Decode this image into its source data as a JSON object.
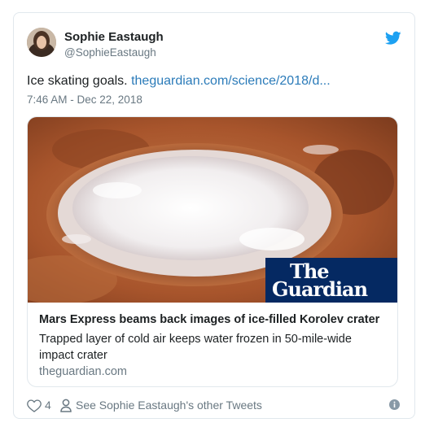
{
  "author": {
    "display_name": "Sophie Eastaugh",
    "handle": "@SophieEastaugh"
  },
  "tweet": {
    "text": "Ice skating goals. ",
    "link_text": "theguardian.com/science/2018/d...",
    "timestamp": "7:46 AM - Dec 22, 2018"
  },
  "link_card": {
    "logo_line1": "The",
    "logo_line2": "Guardian",
    "title": "Mars Express beams back images of ice-filled Korolev crater",
    "description": "Trapped layer of cold air keeps water frozen in 50-mile-wide impact crater",
    "domain": "theguardian.com"
  },
  "footer": {
    "like_count": "4",
    "other_tweets_label": "See Sophie Eastaugh's other Tweets"
  },
  "icons": {
    "twitter": "twitter-bird-icon",
    "heart": "heart-icon",
    "person": "person-icon",
    "info": "info-icon"
  },
  "colors": {
    "link": "#2b7bb9",
    "twitter_blue": "#1da1f2",
    "secondary_text": "#697882",
    "guardian_navy": "#052962"
  }
}
